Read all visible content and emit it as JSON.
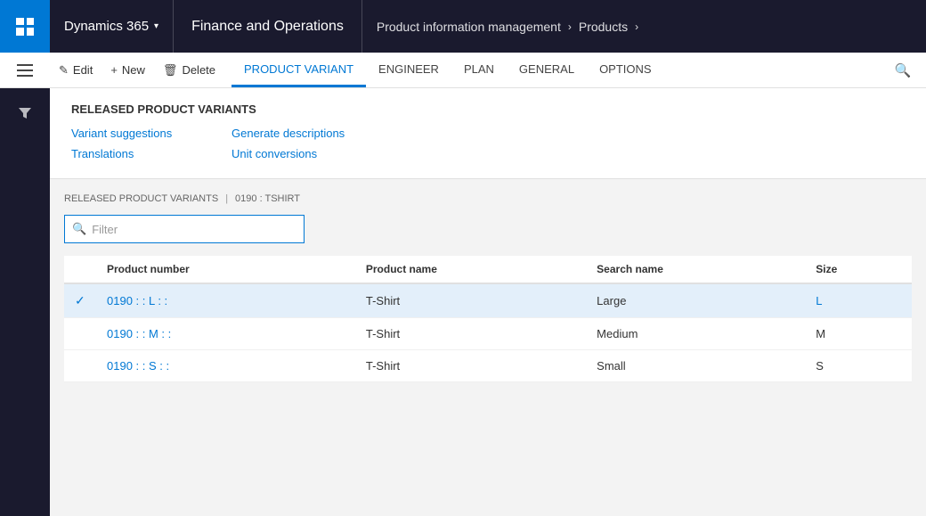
{
  "topNav": {
    "appTitle": "Dynamics 365",
    "chevron": "▾",
    "financeTitle": "Finance and Operations",
    "breadcrumb": {
      "module": "Product information management",
      "chevron": "›",
      "section": "Products",
      "chevronRight": "›"
    }
  },
  "toolbar": {
    "editLabel": "Edit",
    "newLabel": "New",
    "deleteLabel": "Delete",
    "tabs": [
      {
        "id": "product-variant",
        "label": "PRODUCT VARIANT",
        "active": true
      },
      {
        "id": "engineer",
        "label": "ENGINEER",
        "active": false
      },
      {
        "id": "plan",
        "label": "PLAN",
        "active": false
      },
      {
        "id": "general",
        "label": "GENERAL",
        "active": false
      },
      {
        "id": "options",
        "label": "OPTIONS",
        "active": false
      }
    ]
  },
  "actionPanel": {
    "title": "RELEASED PRODUCT VARIANTS",
    "links": [
      {
        "id": "variant-suggestions",
        "label": "Variant suggestions"
      },
      {
        "id": "generate-descriptions",
        "label": "Generate descriptions"
      },
      {
        "id": "translations",
        "label": "Translations"
      },
      {
        "id": "unit-conversions",
        "label": "Unit conversions"
      }
    ]
  },
  "dataPanel": {
    "breadcrumb": "RELEASED PRODUCT VARIANTS",
    "separator": "|",
    "recordId": "0190 : TSHIRT",
    "filter": {
      "placeholder": "Filter",
      "value": ""
    },
    "table": {
      "columns": [
        {
          "id": "check",
          "label": ""
        },
        {
          "id": "product-number",
          "label": "Product number"
        },
        {
          "id": "product-name",
          "label": "Product name"
        },
        {
          "id": "search-name",
          "label": "Search name"
        },
        {
          "id": "size",
          "label": "Size"
        }
      ],
      "rows": [
        {
          "id": "row-l",
          "selected": true,
          "productNumber": "0190 : : L : :",
          "productName": "T-Shirt",
          "searchName": "Large",
          "size": "L",
          "sizeIsLink": true
        },
        {
          "id": "row-m",
          "selected": false,
          "productNumber": "0190 : : M : :",
          "productName": "T-Shirt",
          "searchName": "Medium",
          "size": "M",
          "sizeIsLink": false
        },
        {
          "id": "row-s",
          "selected": false,
          "productNumber": "0190 : : S : :",
          "productName": "T-Shirt",
          "searchName": "Small",
          "size": "S",
          "sizeIsLink": false
        }
      ]
    }
  },
  "icons": {
    "edit": "✎",
    "new": "+",
    "delete": "🗑",
    "search": "🔍",
    "hamburger": "≡",
    "filter": "⊘",
    "funnel": "▽"
  }
}
